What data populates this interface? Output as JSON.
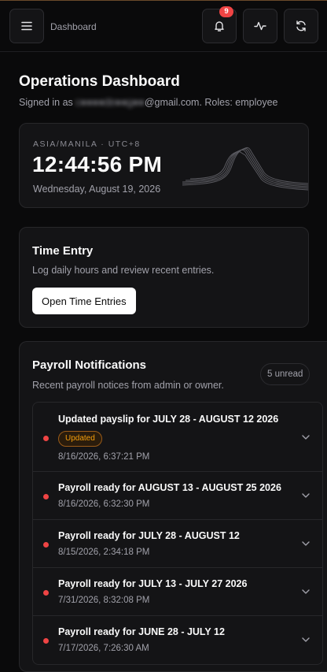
{
  "header": {
    "breadcrumb": "Dashboard",
    "notification_count": "9",
    "icons": [
      "menu-icon",
      "bell-icon",
      "activity-icon",
      "refresh-icon"
    ]
  },
  "page": {
    "title": "Operations Dashboard",
    "signed_in_prefix": "Signed in as",
    "email_redacted": "c●●●●de●●g●●",
    "email_suffix": "@gmail.com. Roles: employee"
  },
  "clock": {
    "timezone": "ASIA/MANILA · UTC+8",
    "time": "12:44:56 PM",
    "date": "Wednesday, August 19, 2026"
  },
  "time_entry": {
    "title": "Time Entry",
    "subtitle": "Log daily hours and review recent entries.",
    "button_label": "Open Time Entries"
  },
  "payroll": {
    "title": "Payroll Notifications",
    "subtitle": "Recent payroll notices from admin or owner.",
    "unread_label": "5 unread",
    "items": [
      {
        "title": "Updated payslip for JULY 28 - AUGUST 12 2026",
        "badge": "Updated",
        "date": "8/16/2026, 6:37:21 PM"
      },
      {
        "title": "Payroll ready for AUGUST 13 - AUGUST 25 2026",
        "date": "8/16/2026, 6:32:30 PM"
      },
      {
        "title": "Payroll ready for JULY 28 - AUGUST 12",
        "date": "8/15/2026, 2:34:18 PM"
      },
      {
        "title": "Payroll ready for JULY 13 - JULY 27 2026",
        "date": "7/31/2026, 8:32:08 PM"
      },
      {
        "title": "Payroll ready for JUNE 28 - JULY 12",
        "date": "7/17/2026, 7:26:30 AM"
      }
    ]
  },
  "colors": {
    "background": "#0a0a0b",
    "card": "#141416",
    "unread_dot": "#ef4444",
    "badge_updated": "#f59e0b"
  }
}
